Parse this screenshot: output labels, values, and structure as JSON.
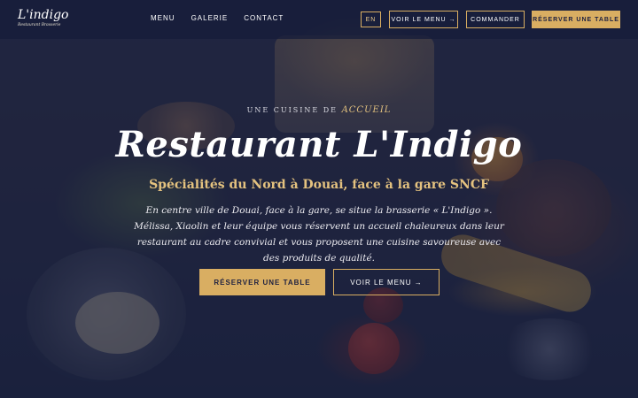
{
  "brand": {
    "name": "L'indigo",
    "subtitle": "Restaurant Brasserie"
  },
  "nav": {
    "links": [
      "MENU",
      "GALERIE",
      "CONTACT"
    ],
    "lang": "EN",
    "menu_button": "VOIR LE MENU →",
    "order_button": "COMMANDER",
    "reserve_button": "RÉSERVER UNE TABLE"
  },
  "hero": {
    "kicker_prefix": "UNE CUISINE DE",
    "kicker_highlight": "ACCUEIL",
    "title": "Restaurant L'Indigo",
    "subtitle": "Spécialités du Nord à Douai, face à la gare SNCF",
    "description": "En centre ville de Douai, face à la gare, se situe la brasserie « L'Indigo ». Mélissa, Xiaolin et leur équipe vous réservent un accueil chaleureux dans leur restaurant au cadre convivial et vous proposent une cuisine savoureuse avec des produits de qualité.",
    "reserve_button": "RÉSERVER UNE TABLE",
    "menu_button": "VOIR LE MENU →"
  },
  "colors": {
    "accent": "#d9ae62",
    "overlay": "#182042"
  }
}
